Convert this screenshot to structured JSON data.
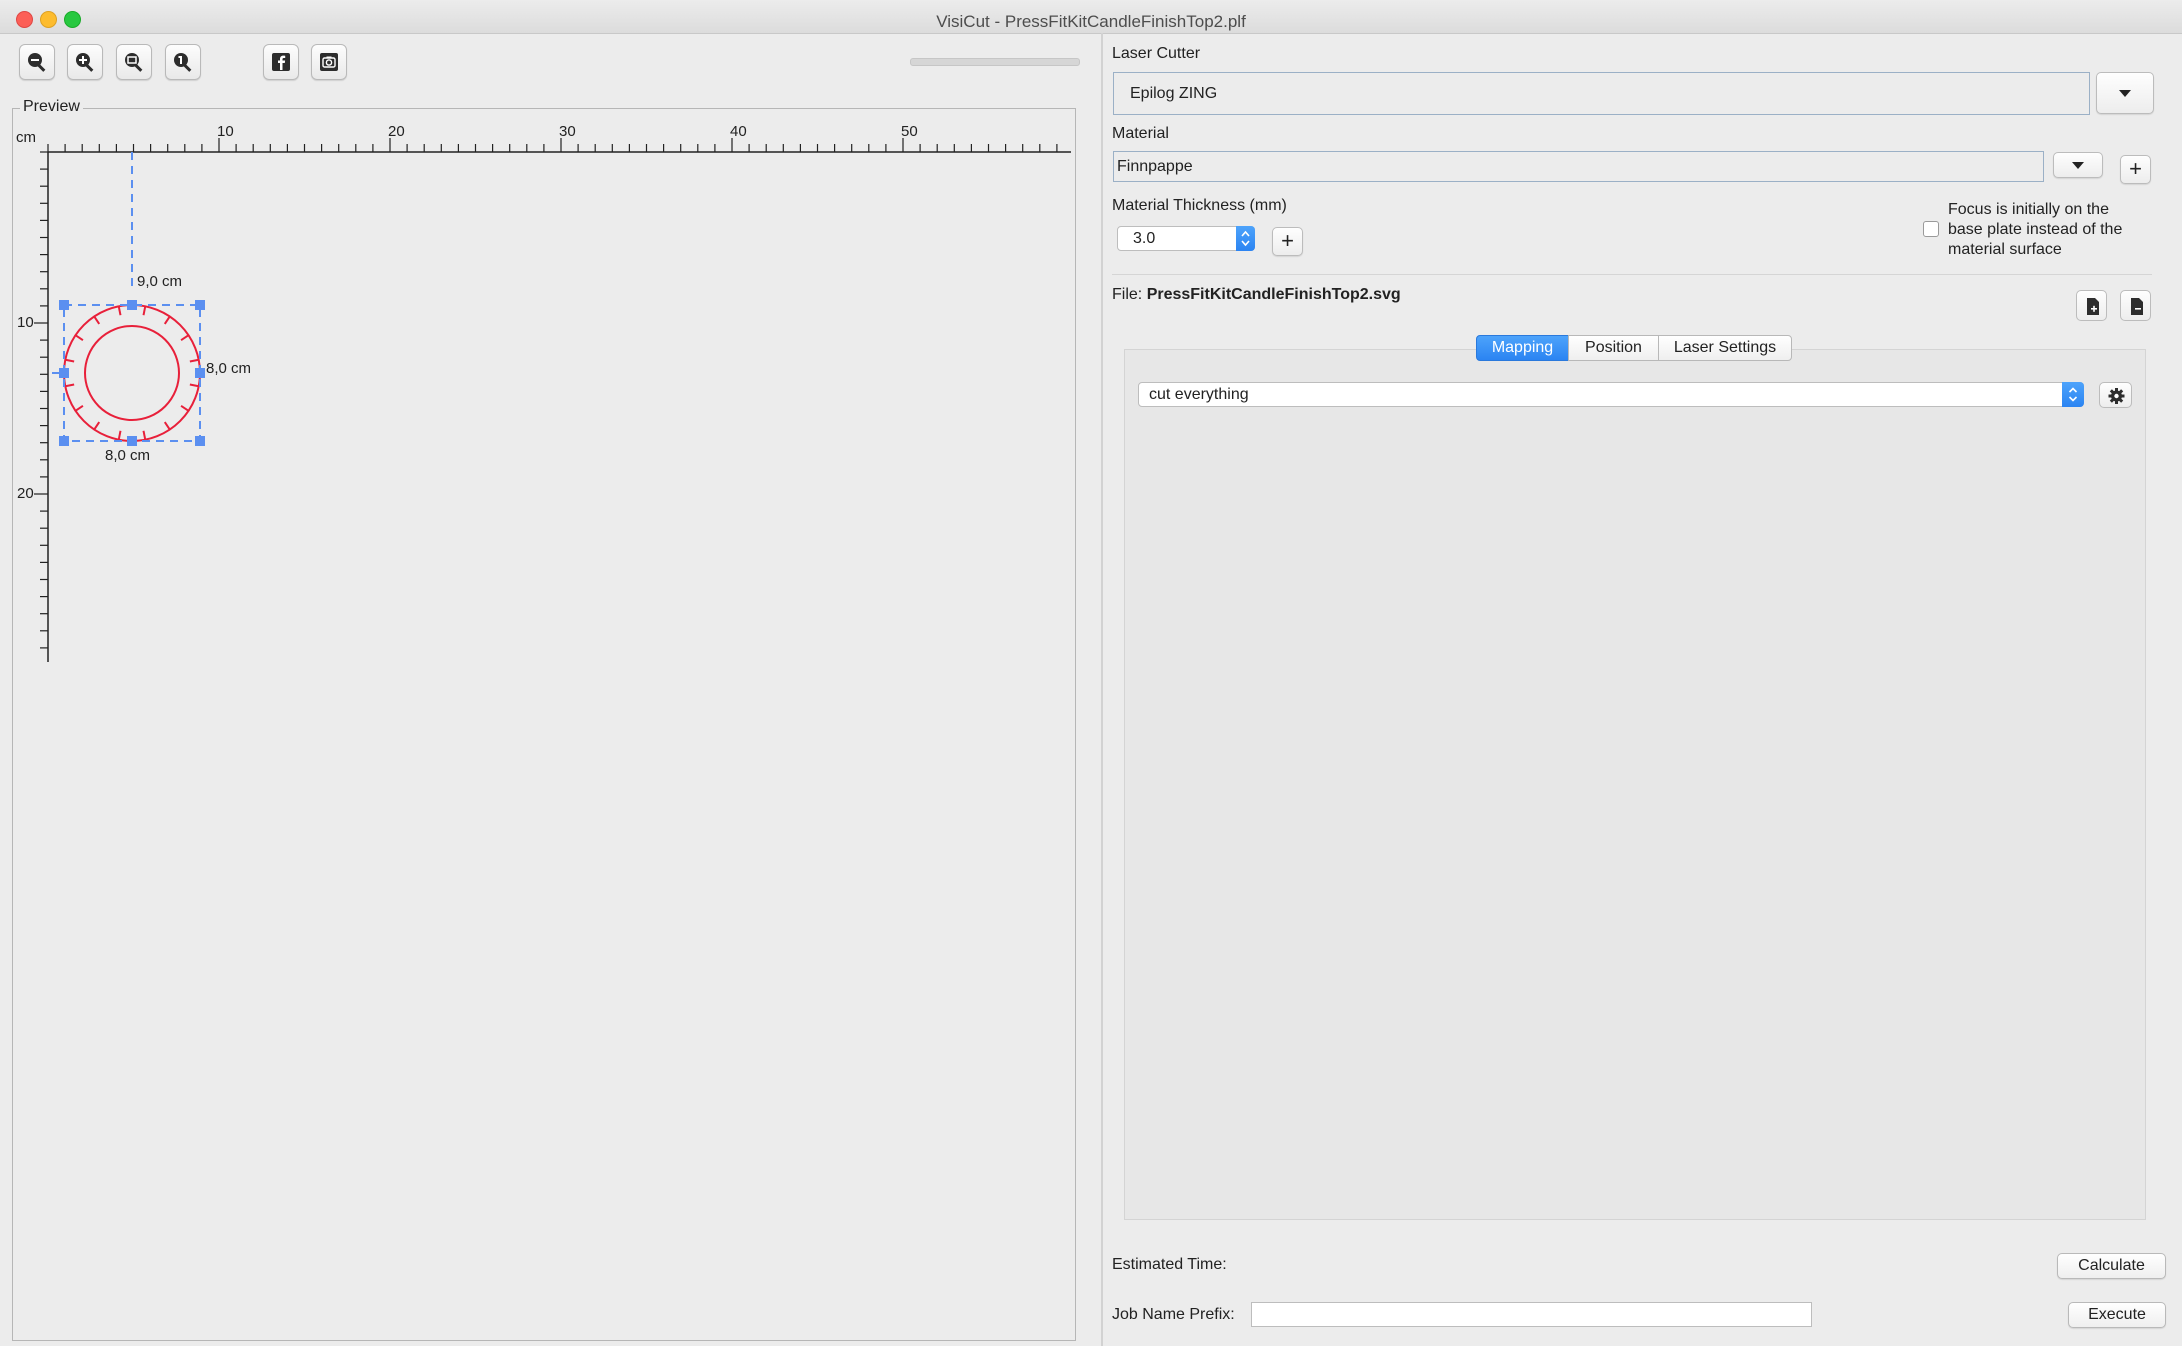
{
  "window": {
    "title": "VisiCut - PressFitKitCandleFinishTop2.plf"
  },
  "toolbar": {
    "buttons": [
      {
        "name": "zoom-out-icon"
      },
      {
        "name": "zoom-in-icon"
      },
      {
        "name": "zoom-fit-icon"
      },
      {
        "name": "zoom-reset-icon"
      },
      {
        "name": "facebook-icon"
      },
      {
        "name": "camera-icon"
      }
    ]
  },
  "preview": {
    "legend": "Preview",
    "unit": "cm",
    "x_ticks": [
      "10",
      "20",
      "30",
      "40",
      "50"
    ],
    "y_ticks": [
      "10",
      "20"
    ],
    "dimensions": {
      "top": "9,0 cm",
      "right": "8,0 cm",
      "bottom": "8,0 cm"
    },
    "colors": {
      "cut_line": "#e8203a",
      "selection": "#5b8ff0"
    }
  },
  "laser_cutter": {
    "label": "Laser Cutter",
    "value": "Epilog ZING"
  },
  "material": {
    "label": "Material",
    "value": "Finnpappe"
  },
  "thickness": {
    "label": "Material Thickness (mm)",
    "value": "3.0"
  },
  "focus": {
    "line1": "Focus is initially on the",
    "line2": "base plate instead of the",
    "line3": "material surface",
    "checked": false
  },
  "file": {
    "label": "File:",
    "name": "PressFitKitCandleFinishTop2.svg"
  },
  "tabs": [
    {
      "label": "Mapping",
      "active": true
    },
    {
      "label": "Position",
      "active": false
    },
    {
      "label": "Laser Settings",
      "active": false
    }
  ],
  "mapping": {
    "selected": "cut everything"
  },
  "footer": {
    "estimated_time_label": "Estimated Time:",
    "calculate_label": "Calculate",
    "job_name_label": "Job Name Prefix:",
    "job_name_value": "",
    "execute_label": "Execute"
  },
  "colors": {
    "accent": "#2b84f2",
    "background": "#ececec"
  }
}
